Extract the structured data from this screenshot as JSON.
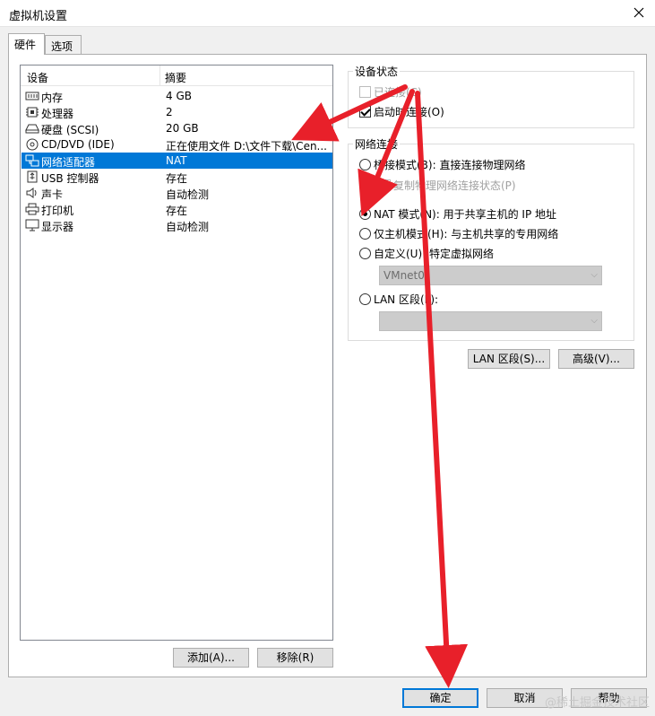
{
  "window": {
    "title": "虚拟机设置"
  },
  "tabs": [
    {
      "label": "硬件"
    },
    {
      "label": "选项"
    }
  ],
  "device_list": {
    "col_device": "设备",
    "col_summary": "摘要",
    "rows": [
      {
        "name": "内存",
        "summary": "4 GB",
        "icon": "memory-icon"
      },
      {
        "name": "处理器",
        "summary": "2",
        "icon": "processor-icon"
      },
      {
        "name": "硬盘 (SCSI)",
        "summary": "20 GB",
        "icon": "hard-disk-icon"
      },
      {
        "name": "CD/DVD (IDE)",
        "summary": "正在使用文件 D:\\文件下载\\Cen...",
        "icon": "cd-dvd-icon"
      },
      {
        "name": "网络适配器",
        "summary": "NAT",
        "icon": "network-adapter-icon",
        "selected": true
      },
      {
        "name": "USB 控制器",
        "summary": "存在",
        "icon": "usb-icon"
      },
      {
        "name": "声卡",
        "summary": "自动检测",
        "icon": "sound-card-icon"
      },
      {
        "name": "打印机",
        "summary": "存在",
        "icon": "printer-icon"
      },
      {
        "name": "显示器",
        "summary": "自动检测",
        "icon": "display-icon"
      }
    ]
  },
  "buttons": {
    "add": "添加(A)...",
    "remove": "移除(R)",
    "lan_segments": "LAN 区段(S)...",
    "advanced": "高级(V)...",
    "ok": "确定",
    "cancel": "取消",
    "help": "帮助"
  },
  "device_status": {
    "label": "设备状态",
    "connected": {
      "label": "已连接(C)",
      "checked": false,
      "enabled": false
    },
    "connect_at_power_on": {
      "label": "启动时连接(O)",
      "checked": true
    }
  },
  "network_connection": {
    "label": "网络连接",
    "bridged": {
      "label": "桥接模式(B): 直接连接物理网络",
      "checked": false
    },
    "replicate": {
      "label": "复制物理网络连接状态(P)",
      "enabled": false
    },
    "nat": {
      "label": "NAT 模式(N): 用于共享主机的 IP 地址",
      "checked": true
    },
    "host_only": {
      "label": "仅主机模式(H): 与主机共享的专用网络",
      "checked": false
    },
    "custom": {
      "label": "自定义(U): 特定虚拟网络",
      "checked": false
    },
    "custom_select": {
      "value": "VMnet0"
    },
    "lan_segment": {
      "label": "LAN 区段(L):",
      "checked": false
    },
    "lan_select": {
      "value": ""
    }
  },
  "watermark": "@稀土掘金技术社区",
  "colors": {
    "selection": "#0078d7",
    "arrow": "#e8202a"
  }
}
